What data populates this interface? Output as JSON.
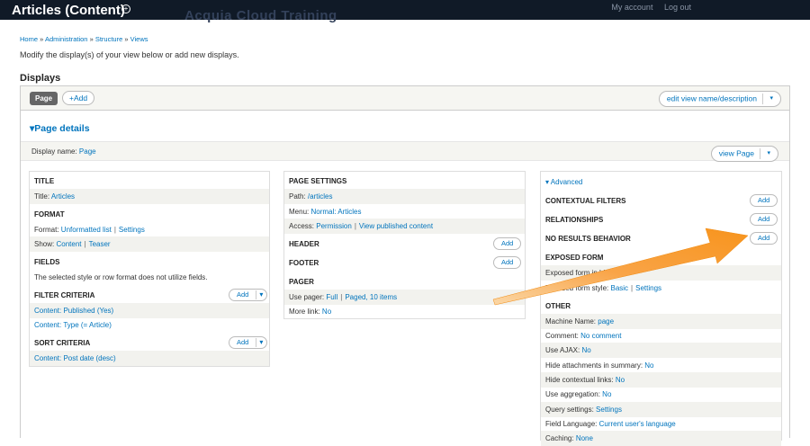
{
  "topbar": {
    "title": "Articles (Content)",
    "ghost_text": "Acquia Cloud Training",
    "my_account": "My account",
    "logout": "Log out"
  },
  "breadcrumb": [
    "Home",
    "Administration",
    "Structure",
    "Views"
  ],
  "intro": "Modify the display(s) of your view below or add new displays.",
  "displays_heading": "Displays",
  "display_tab": "Page",
  "add_display": "+Add",
  "edit_view_btn": "edit view name/description",
  "page_details": "Page details",
  "display_name_label": "Display name:",
  "display_name_value": "Page",
  "view_page_btn": "view Page",
  "col1": {
    "title_h": "TITLE",
    "title_label": "Title:",
    "title_value": "Articles",
    "format_h": "FORMAT",
    "format_label": "Format:",
    "format_value": "Unformatted list",
    "format_settings": "Settings",
    "show_label": "Show:",
    "show_value": "Content",
    "show_teaser": "Teaser",
    "fields_h": "FIELDS",
    "fields_note": "The selected style or row format does not utilize fields.",
    "filter_h": "FILTER CRITERIA",
    "filter_add": "Add",
    "filter_1": "Content: Published (Yes)",
    "filter_2": "Content: Type (= Article)",
    "sort_h": "SORT CRITERIA",
    "sort_add": "Add",
    "sort_1": "Content: Post date (desc)"
  },
  "col2": {
    "page_settings_h": "PAGE SETTINGS",
    "path_label": "Path:",
    "path_value": "/articles",
    "menu_label": "Menu:",
    "menu_value": "Normal: Articles",
    "access_label": "Access:",
    "access_value": "Permission",
    "access_view": "View published content",
    "header_h": "HEADER",
    "header_add": "Add",
    "footer_h": "FOOTER",
    "footer_add": "Add",
    "pager_h": "PAGER",
    "use_pager_label": "Use pager:",
    "use_pager_value": "Full",
    "use_pager_paged": "Paged, 10 items",
    "more_link_label": "More link:",
    "more_link_value": "No"
  },
  "col3": {
    "advanced": "Advanced",
    "contextual_h": "CONTEXTUAL FILTERS",
    "contextual_add": "Add",
    "relationships_h": "RELATIONSHIPS",
    "relationships_add": "Add",
    "noresults_h": "NO RESULTS BEHAVIOR",
    "noresults_add": "Add",
    "exposed_h": "EXPOSED FORM",
    "exposed_block_label": "Exposed form in block:",
    "exposed_block_value": "No",
    "exposed_style_label": "Exposed form style:",
    "exposed_style_value": "Basic",
    "exposed_style_settings": "Settings",
    "other_h": "OTHER",
    "rows": [
      {
        "label": "Machine Name:",
        "value": "page"
      },
      {
        "label": "Comment:",
        "value": "No comment"
      },
      {
        "label": "Use AJAX:",
        "value": "No"
      },
      {
        "label": "Hide attachments in summary:",
        "value": "No"
      },
      {
        "label": "Hide contextual links:",
        "value": "No"
      },
      {
        "label": "Use aggregation:",
        "value": "No"
      },
      {
        "label": "Query settings:",
        "value": "Settings"
      },
      {
        "label": "Field Language:",
        "value": "Current user's language"
      },
      {
        "label": "Caching:",
        "value": "None"
      }
    ]
  },
  "colors": {
    "topbar": "#101a27",
    "link": "#0074bd",
    "arrow": "#f7941d"
  }
}
